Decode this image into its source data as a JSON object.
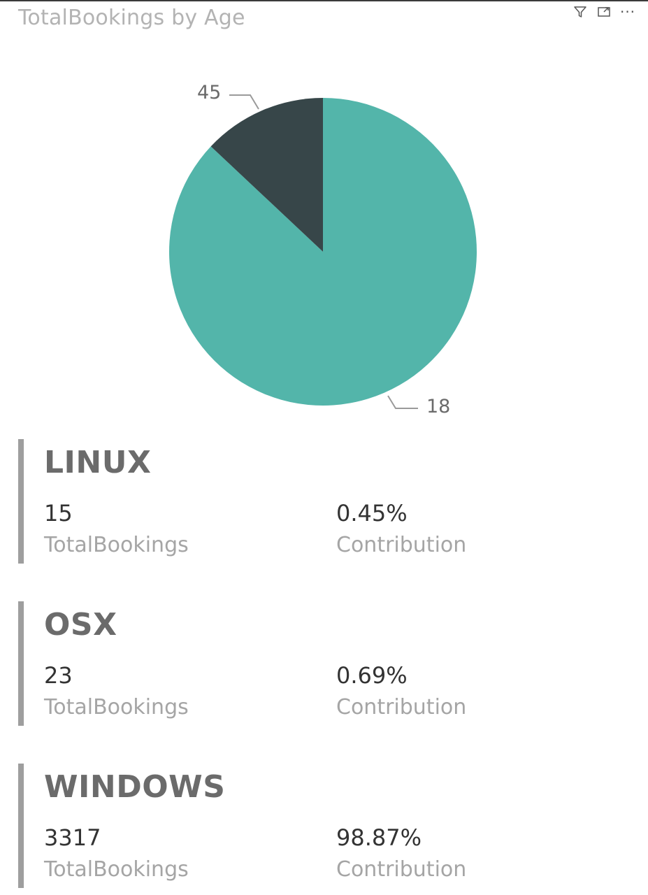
{
  "visual": {
    "title": "TotalBookings by Age",
    "icons": [
      "filter-icon",
      "focus-mode-icon",
      "more-options-icon"
    ]
  },
  "chart_data": {
    "type": "pie",
    "title": "TotalBookings by Age",
    "slices": [
      {
        "label": "18",
        "value": 87,
        "color": "#53b5aa"
      },
      {
        "label": "45",
        "value": 13,
        "color": "#374649"
      }
    ]
  },
  "cards": [
    {
      "name": "LINUX",
      "value1": "15",
      "label1": "TotalBookings",
      "value2": "0.45%",
      "label2": "Contribution"
    },
    {
      "name": "OSX",
      "value1": "23",
      "label1": "TotalBookings",
      "value2": "0.69%",
      "label2": "Contribution"
    },
    {
      "name": "WINDOWS",
      "value1": "3317",
      "label1": "TotalBookings",
      "value2": "98.87%",
      "label2": "Contribution"
    }
  ],
  "colors": {
    "bar": "#9e9e9e",
    "teal": "#53b5aa",
    "dark": "#374649"
  }
}
